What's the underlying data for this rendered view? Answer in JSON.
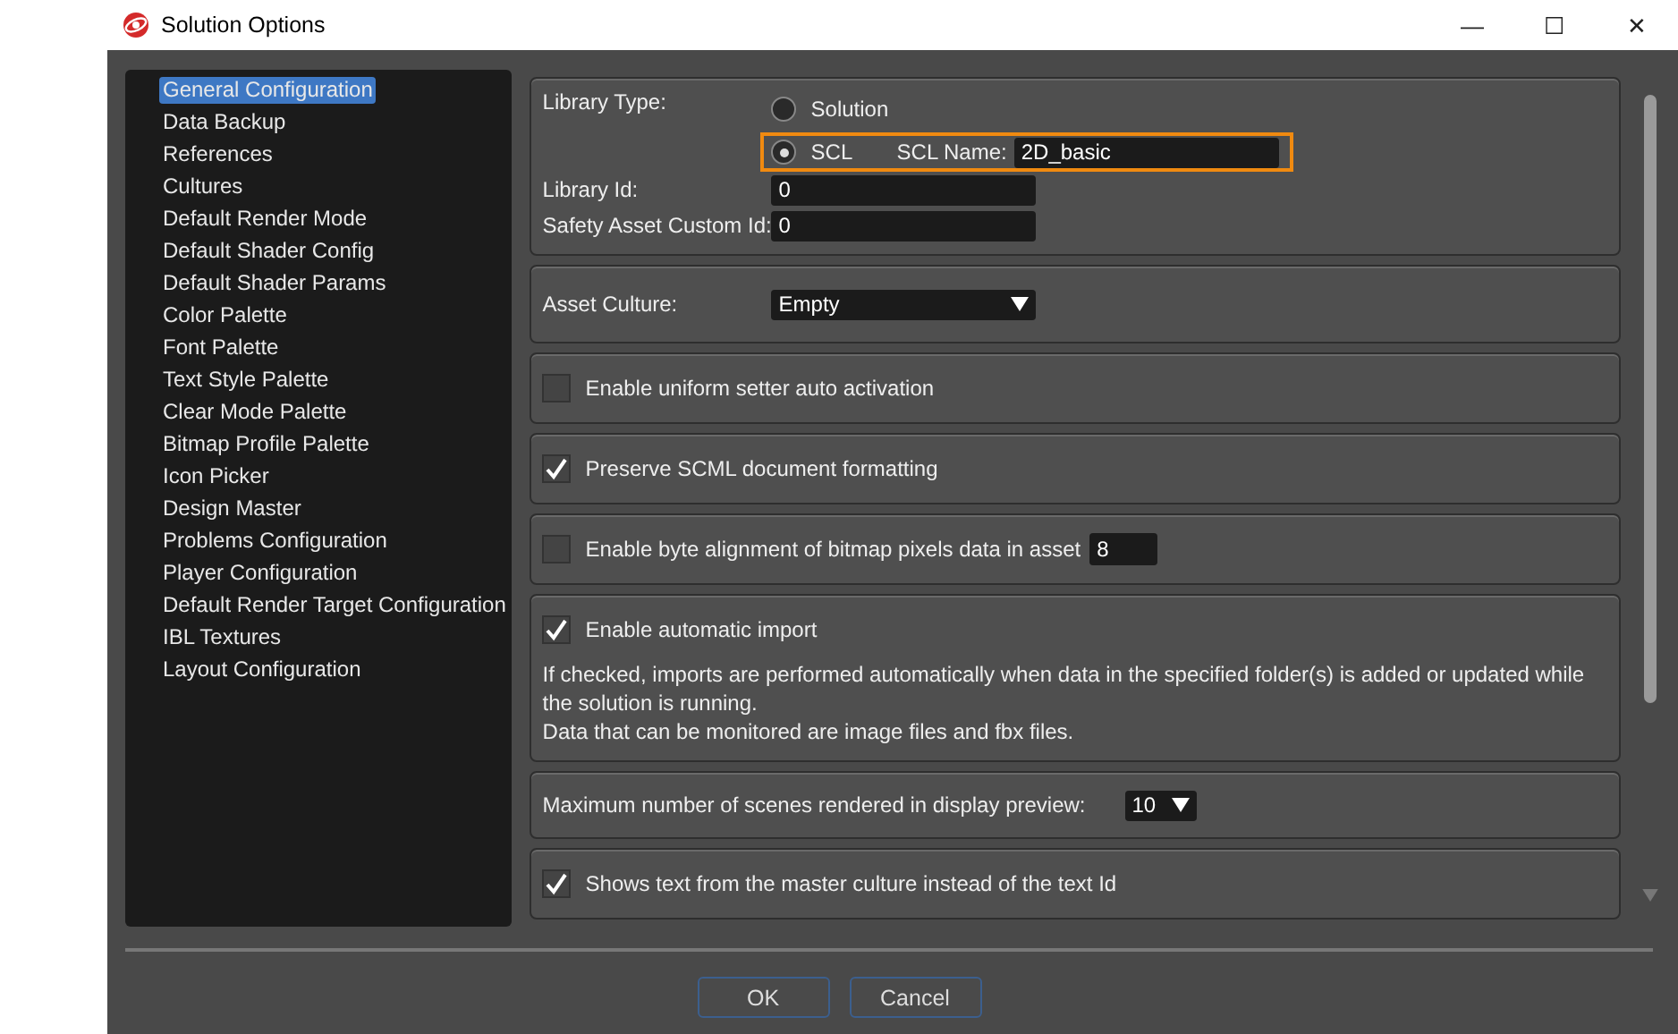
{
  "window": {
    "title": "Solution Options",
    "controls": [
      "—",
      "☐",
      "✕"
    ]
  },
  "sidebar": {
    "items": [
      {
        "label": "General Configuration",
        "selected": true
      },
      {
        "label": "Data Backup",
        "selected": false
      },
      {
        "label": "References",
        "selected": false
      },
      {
        "label": "Cultures",
        "selected": false
      },
      {
        "label": "Default Render Mode",
        "selected": false
      },
      {
        "label": "Default Shader Config",
        "selected": false
      },
      {
        "label": "Default Shader Params",
        "selected": false
      },
      {
        "label": "Color Palette",
        "selected": false
      },
      {
        "label": "Font Palette",
        "selected": false
      },
      {
        "label": "Text Style Palette",
        "selected": false
      },
      {
        "label": "Clear Mode Palette",
        "selected": false
      },
      {
        "label": "Bitmap Profile Palette",
        "selected": false
      },
      {
        "label": "Icon Picker",
        "selected": false
      },
      {
        "label": "Design Master",
        "selected": false
      },
      {
        "label": "Problems Configuration",
        "selected": false
      },
      {
        "label": "Player Configuration",
        "selected": false
      },
      {
        "label": "Default Render Target Configuration",
        "selected": false
      },
      {
        "label": "IBL Textures",
        "selected": false
      },
      {
        "label": "Layout Configuration",
        "selected": false
      }
    ]
  },
  "sections": [
    {
      "kind": "library",
      "label": "Library Type:",
      "options": [
        {
          "label": "Solution",
          "selected": false
        },
        {
          "label": "SCL",
          "selected": true
        }
      ],
      "scl_name_label": "SCL Name:",
      "scl_name": "2D_basic",
      "highlighted": true,
      "library_id_label": "Library Id:",
      "library_id": "0",
      "safety_label": "Safety Asset Custom Id:",
      "safety_id": "0"
    },
    {
      "kind": "dropdown",
      "label": "Asset Culture:",
      "value": "Empty"
    },
    {
      "kind": "checkbox",
      "label": "Enable uniform setter auto activation",
      "checked": false
    },
    {
      "kind": "checkbox",
      "label": "Preserve SCML document formatting",
      "checked": true
    },
    {
      "kind": "checkbox",
      "label": "Enable byte alignment of bitmap pixels data in asset",
      "checked": false,
      "value": "8"
    },
    {
      "kind": "checkbox",
      "label": "Enable automatic import",
      "checked": true,
      "notes": [
        "If checked, imports are performed automatically when data in the specified folder(s) is added or updated while the solution is running.",
        "Data that can be monitored are image files and fbx files."
      ]
    },
    {
      "kind": "count",
      "label": "Maximum number of scenes rendered in display preview:",
      "value": "10"
    },
    {
      "kind": "checkbox",
      "label": "Shows text from the master culture instead of the text Id",
      "checked": true
    }
  ],
  "buttons": [
    "OK",
    "Cancel"
  ]
}
